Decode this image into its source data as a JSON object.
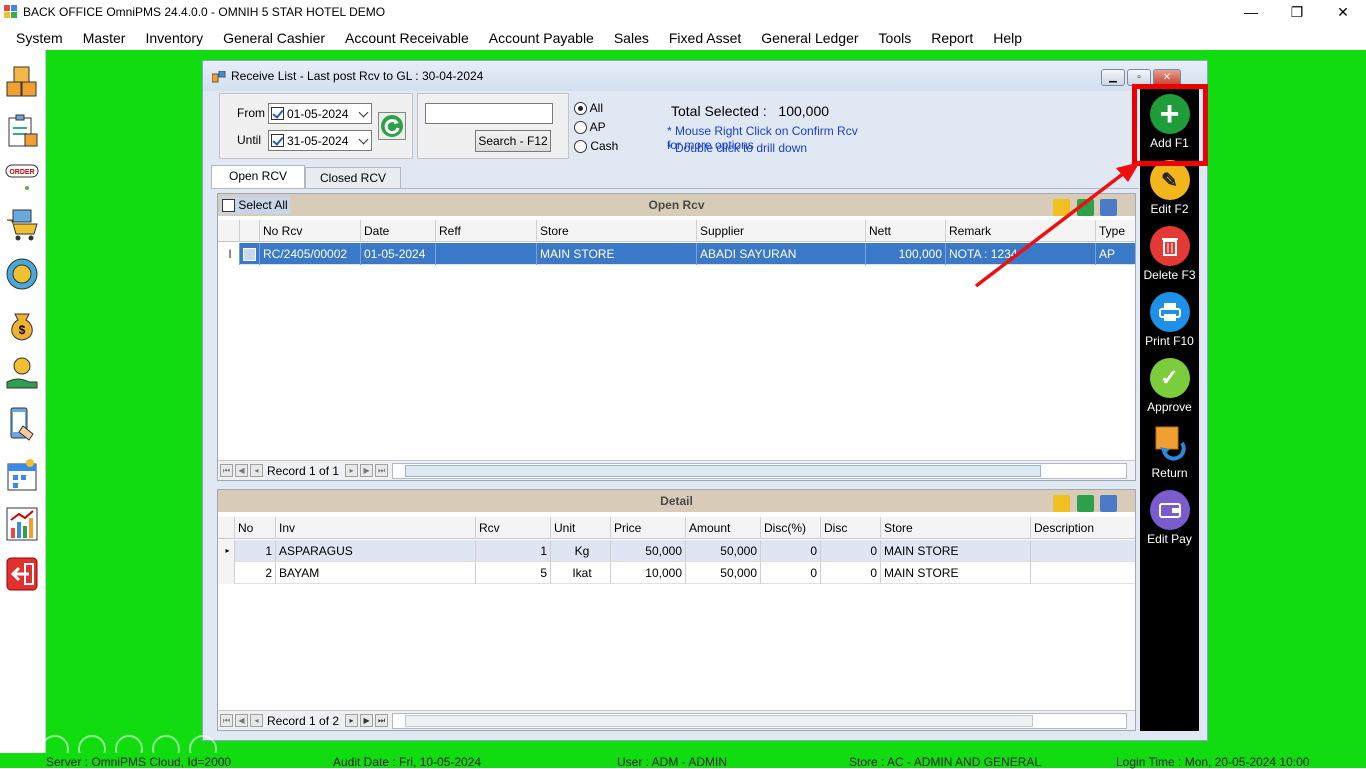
{
  "app": {
    "title": "BACK OFFICE OmniPMS 24.4.0.0 - OMNIH 5 STAR HOTEL DEMO",
    "window_controls": {
      "minimize": "—",
      "restore": "❐",
      "close": "✕"
    }
  },
  "menu": [
    "System",
    "Master",
    "Inventory",
    "General Cashier",
    "Account Receivable",
    "Account Payable",
    "Sales",
    "Fixed Asset",
    "General Ledger",
    "Tools",
    "Report",
    "Help"
  ],
  "left_toolbar": [
    "boxes-icon",
    "clipboard-icon",
    "order-icon",
    "cart-icon",
    "sync-icon",
    "money-bag-icon",
    "hand-money-icon",
    "phone-icon",
    "calendar-icon",
    "chart-icon",
    "exit-icon"
  ],
  "left_toolbar_order_label": "ORDER",
  "window": {
    "title": "Receive List - Last post Rcv to GL : 30-04-2024"
  },
  "filter": {
    "from_label": "From",
    "from_date": "01-05-2024",
    "until_label": "Until",
    "until_date": "31-05-2024",
    "search_value": "",
    "search_button": "Search - F12",
    "radio_all": "All",
    "radio_ap": "AP",
    "radio_cash": "Cash",
    "selected_radio": "All",
    "total_label": "Total Selected :",
    "total_value": "100,000",
    "hint1": "* Mouse Right Click on Confirm Rcv for more options",
    "hint2": "* Double click to drill down"
  },
  "tabs": {
    "open": "Open RCV",
    "closed": "Closed RCV",
    "active": "Open RCV"
  },
  "open_grid": {
    "header": "Open Rcv",
    "select_all": "Select All",
    "columns": [
      "No Rcv",
      "Date",
      "Reff",
      "Store",
      "Supplier",
      "Nett",
      "Remark",
      "Type"
    ],
    "rows": [
      {
        "no": "RC/2405/00002",
        "date": "01-05-2024",
        "reff": "",
        "store": "MAIN STORE",
        "supplier": "ABADI SAYURAN",
        "nett": "100,000",
        "remark": "NOTA : 1234",
        "type": "AP"
      }
    ],
    "row_cursor": "I",
    "pager": "Record 1 of 1"
  },
  "detail_grid": {
    "header": "Detail",
    "columns": [
      "No",
      "Inv",
      "Rcv",
      "Unit",
      "Price",
      "Amount",
      "Disc(%)",
      "Disc",
      "Store",
      "Description"
    ],
    "rows": [
      {
        "no": "1",
        "inv": "ASPARAGUS",
        "rcv": "1",
        "unit": "Kg",
        "price": "50,000",
        "amount": "50,000",
        "discp": "0",
        "disc": "0",
        "store": "MAIN STORE",
        "desc": ""
      },
      {
        "no": "2",
        "inv": "BAYAM",
        "rcv": "5",
        "unit": "Ikat",
        "price": "10,000",
        "amount": "50,000",
        "discp": "0",
        "disc": "0",
        "store": "MAIN STORE",
        "desc": ""
      }
    ],
    "pager": "Record 1 of 2"
  },
  "actions": [
    {
      "label": "Add F1",
      "icon": "plus-icon",
      "color": "#1f9d3a"
    },
    {
      "label": "Edit F2",
      "icon": "edit-icon",
      "color": "#f2b51c"
    },
    {
      "label": "Delete F3",
      "icon": "trash-icon",
      "color": "#e53935"
    },
    {
      "label": "Print F10",
      "icon": "printer-icon",
      "color": "#1e90e8"
    },
    {
      "label": "Approve",
      "icon": "check-icon",
      "color": "#7ccd3c"
    },
    {
      "label": "Return",
      "icon": "return-icon",
      "color": "#f0a030"
    },
    {
      "label": "Edit Pay",
      "icon": "wallet-icon",
      "color": "#7a5ccf"
    }
  ],
  "status": {
    "server": "Server : OmniPMS Cloud, Id=2000",
    "audit": "Audit Date : Fri, 10-05-2024",
    "user": "User : ADM - ADMIN",
    "store": "Store : AC - ADMIN AND GENERAL",
    "login": "Login Time : Mon, 20-05-2024 10:00"
  },
  "colors": {
    "desktop": "#10dc10",
    "highlight": "#ee0000",
    "selected_row": "#3a78c8"
  }
}
